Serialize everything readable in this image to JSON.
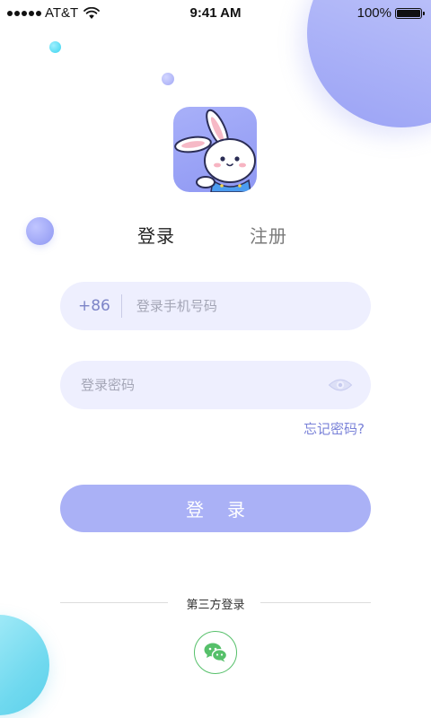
{
  "status_bar": {
    "carrier": "AT&T",
    "time": "9:41 AM",
    "battery_percent": "100%"
  },
  "tabs": {
    "login": "登录",
    "register": "注册",
    "active": "login"
  },
  "phone_field": {
    "country_code": "+86",
    "placeholder": "登录手机号码",
    "value": ""
  },
  "password_field": {
    "placeholder": "登录密码",
    "value": ""
  },
  "forgot_password": "忘记密码?",
  "login_button": "登录",
  "third_party": {
    "label": "第三方登录",
    "providers": [
      "wechat-icon"
    ]
  },
  "colors": {
    "accent": "#8f98f3",
    "input_bg": "#eeeffe",
    "button_bg": "#aab1f6",
    "link": "#7a82d8",
    "wechat": "#56c06a"
  }
}
